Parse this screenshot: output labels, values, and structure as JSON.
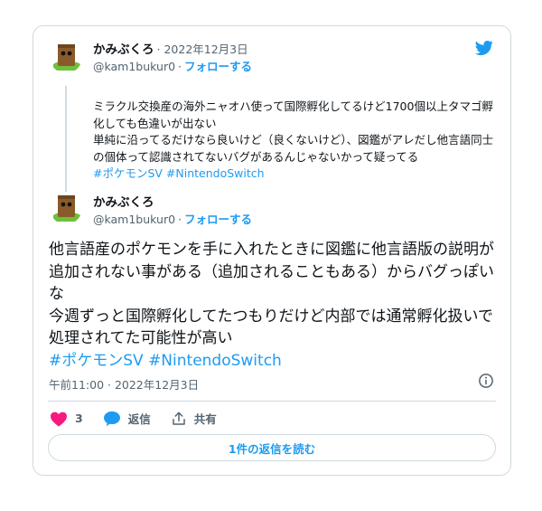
{
  "brand": {
    "twitter_color": "#1d9bf0",
    "like_color": "#f91880"
  },
  "quoted_tweet": {
    "author_name": "かみぶくろ",
    "date": "2022年12月3日",
    "handle": "@kam1bukur0",
    "separator": "·",
    "follow_label": "フォローする",
    "text_lines": [
      "ミラクル交換産の海外ニャオハ使って国際孵化してるけど1700個以上タマゴ孵化しても色違いが出ない",
      "単純に沿ってるだけなら良いけど（良くないけど）、図鑑がアレだし他言語同士の個体って認識されてないバグがあるんじゃないかって疑ってる"
    ],
    "hashtags": "#ポケモンSV #NintendoSwitch"
  },
  "main_tweet": {
    "author_name": "かみぶくろ",
    "handle": "@kam1bukur0",
    "separator": "·",
    "follow_label": "フォローする",
    "text_lines": [
      "他言語産のポケモンを手に入れたときに図鑑に他言語版の説明が追加されない事がある（追加されることもある）からバグっぽいな",
      "今週ずっと国際孵化してたつもりだけど内部では通常孵化扱いで処理されてた可能性が高い"
    ],
    "hashtags": "#ポケモンSV #NintendoSwitch",
    "timestamp": "午前11:00 · 2022年12月3日"
  },
  "actions": {
    "like_count": "3",
    "reply_label": "返信",
    "share_label": "共有"
  },
  "read_replies_label": "1件の返信を読む",
  "icons": [
    "twitter-bird-icon",
    "info-icon",
    "heart-icon",
    "reply-bubble-icon",
    "share-icon"
  ]
}
